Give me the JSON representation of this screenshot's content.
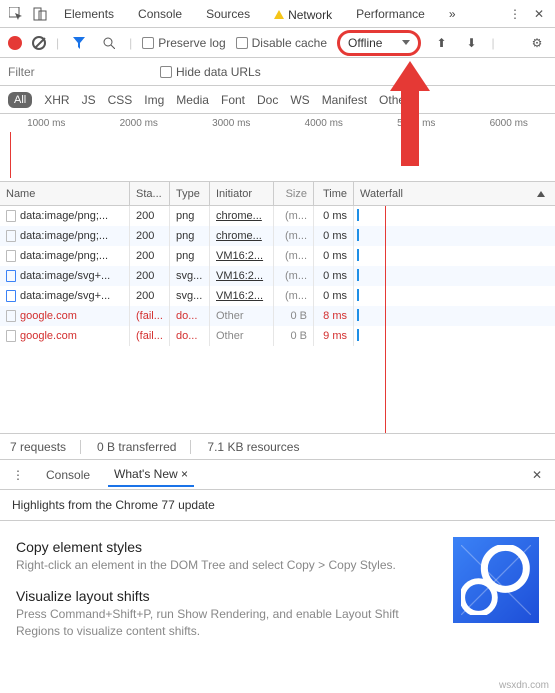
{
  "tabs": {
    "elements": "Elements",
    "console": "Console",
    "sources": "Sources",
    "network": "Network",
    "performance": "Performance",
    "more": "»"
  },
  "toolbar": {
    "preserve": "Preserve log",
    "disable_cache": "Disable cache",
    "throttle": "Offline"
  },
  "filter": {
    "placeholder": "Filter",
    "hide_urls": "Hide data URLs"
  },
  "types": {
    "all": "All",
    "xhr": "XHR",
    "js": "JS",
    "css": "CSS",
    "img": "Img",
    "media": "Media",
    "font": "Font",
    "doc": "Doc",
    "ws": "WS",
    "manifest": "Manifest",
    "other": "Other"
  },
  "ticks": [
    "1000 ms",
    "2000 ms",
    "3000 ms",
    "4000 ms",
    "5000 ms",
    "6000 ms"
  ],
  "cols": {
    "name": "Name",
    "status": "Sta...",
    "type": "Type",
    "initiator": "Initiator",
    "size": "Size",
    "time": "Time",
    "waterfall": "Waterfall"
  },
  "rows": [
    {
      "name": "data:image/png;...",
      "status": "200",
      "type": "png",
      "initiator": "chrome...",
      "init_gray": false,
      "size": "(m...",
      "time": "0 ms",
      "fail": false,
      "icon": "docf"
    },
    {
      "name": "data:image/png;...",
      "status": "200",
      "type": "png",
      "initiator": "chrome...",
      "init_gray": false,
      "size": "(m...",
      "time": "0 ms",
      "fail": false,
      "icon": "docf"
    },
    {
      "name": "data:image/png;...",
      "status": "200",
      "type": "png",
      "initiator": "VM16:2...",
      "init_gray": false,
      "size": "(m...",
      "time": "0 ms",
      "fail": false,
      "icon": "docf"
    },
    {
      "name": "data:image/svg+...",
      "status": "200",
      "type": "svg...",
      "initiator": "VM16:2...",
      "init_gray": false,
      "size": "(m...",
      "time": "0 ms",
      "fail": false,
      "icon": "svgf"
    },
    {
      "name": "data:image/svg+...",
      "status": "200",
      "type": "svg...",
      "initiator": "VM16:2...",
      "init_gray": false,
      "size": "(m...",
      "time": "0 ms",
      "fail": false,
      "icon": "svgf"
    },
    {
      "name": "google.com",
      "status": "(fail...",
      "type": "do...",
      "initiator": "Other",
      "init_gray": true,
      "size": "0 B",
      "time": "8 ms",
      "fail": true,
      "icon": "docf"
    },
    {
      "name": "google.com",
      "status": "(fail...",
      "type": "do...",
      "initiator": "Other",
      "init_gray": true,
      "size": "0 B",
      "time": "9 ms",
      "fail": true,
      "icon": "docf"
    }
  ],
  "summary": {
    "requests": "7 requests",
    "transferred": "0 B transferred",
    "resources": "7.1 KB resources"
  },
  "drawer": {
    "console": "Console",
    "whatsnew": "What's New"
  },
  "highlights": "Highlights from the Chrome 77 update",
  "features": [
    {
      "title": "Copy element styles",
      "desc": "Right-click an element in the DOM Tree and select Copy > Copy Styles."
    },
    {
      "title": "Visualize layout shifts",
      "desc": "Press Command+Shift+P, run Show Rendering, and enable Layout Shift Regions to visualize content shifts."
    }
  ],
  "watermark": "wsxdn.com"
}
